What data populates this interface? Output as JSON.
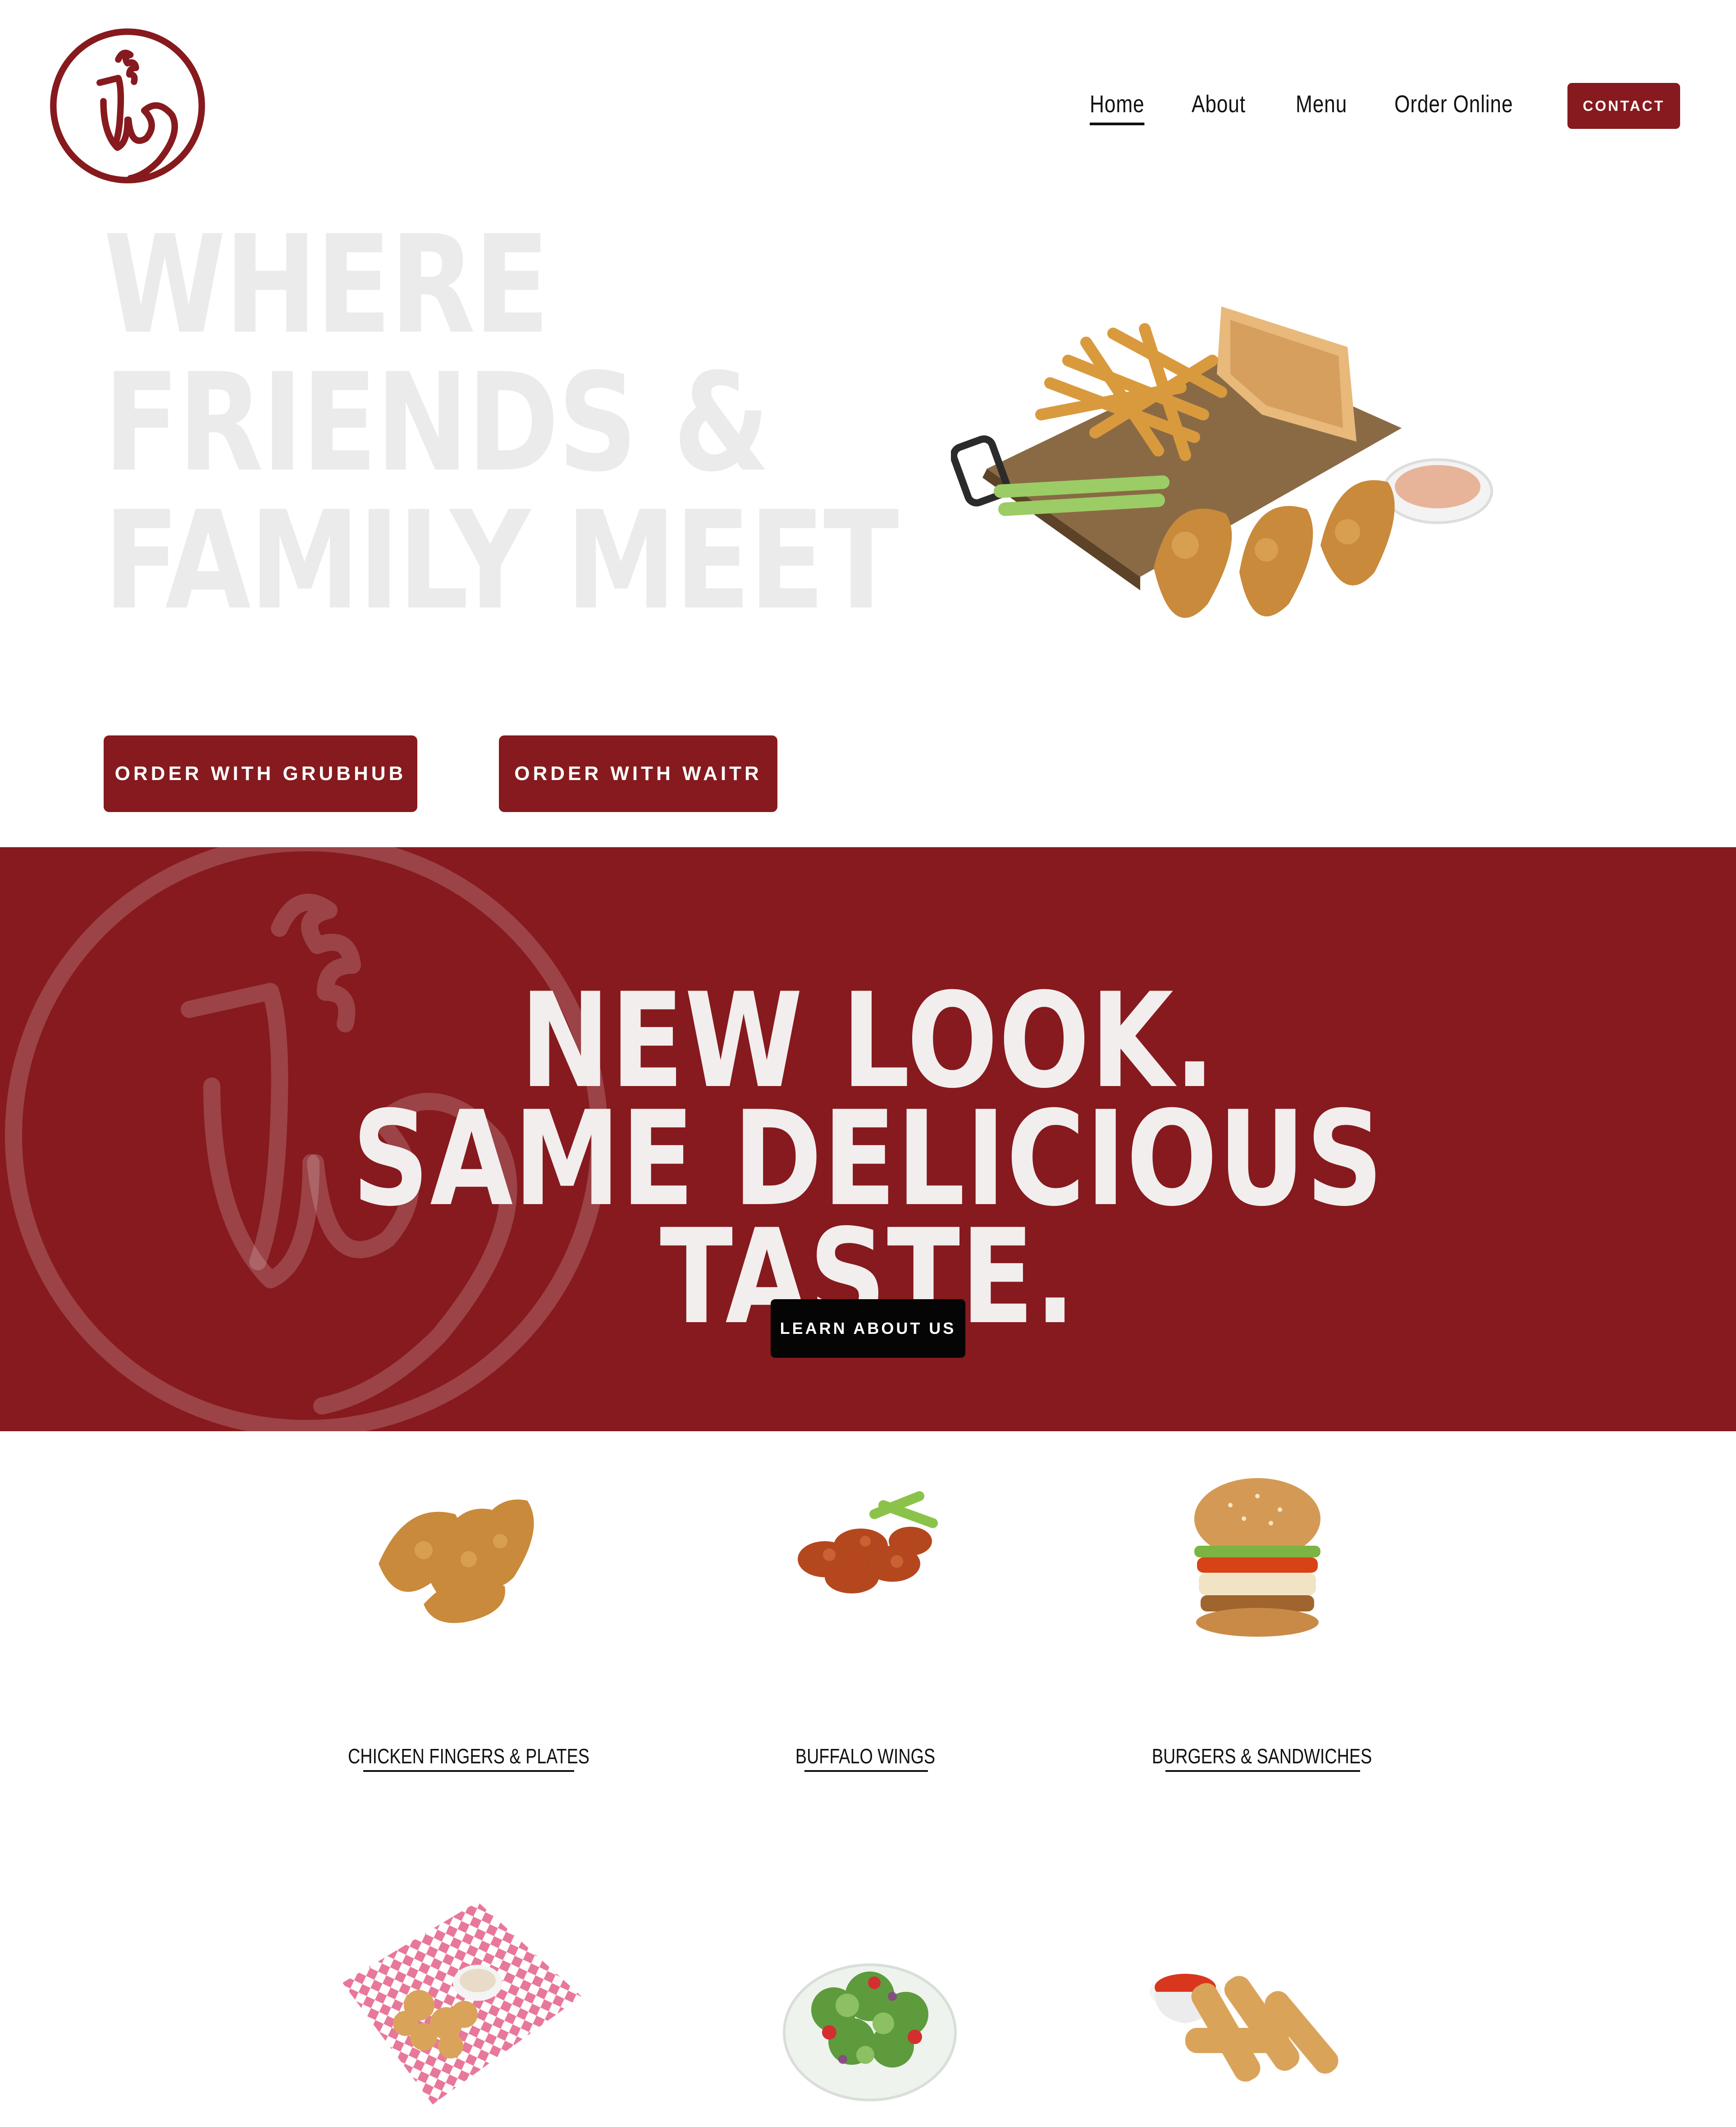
{
  "brand": {
    "color": "#861a1e",
    "logo_icon": "rooster-logo-icon"
  },
  "nav": {
    "items": [
      {
        "label": "Home",
        "active": true
      },
      {
        "label": "About",
        "active": false
      },
      {
        "label": "Menu",
        "active": false
      },
      {
        "label": "Order Online",
        "active": false
      }
    ],
    "contact_label": "CONTACT"
  },
  "hero": {
    "headline_lines": [
      "WHERE",
      "FRIENDS &",
      "FAMILY MEET"
    ],
    "image": "chicken-fingers-plate-photo",
    "buttons": {
      "grubhub": "ORDER WITH GRUBHUB",
      "waitr": "ORDER WITH WAITR"
    }
  },
  "banner": {
    "line1": "NEW LOOK.",
    "line2": "SAME DELICIOUS TASTE.",
    "button_label": "LEARN ABOUT US",
    "watermark": "rooster-logo-watermark"
  },
  "menu": {
    "items": [
      {
        "label": "CHICKEN FINGERS & PLATES",
        "image": "chicken-fingers-photo"
      },
      {
        "label": "BUFFALO WINGS",
        "image": "buffalo-wings-photo"
      },
      {
        "label": "BURGERS & SANDWICHES",
        "image": "burger-photo"
      },
      {
        "label": "",
        "image": "fried-bites-basket-photo"
      },
      {
        "label": "",
        "image": "salad-photo"
      },
      {
        "label": "",
        "image": "mozzarella-sticks-photo"
      }
    ]
  }
}
